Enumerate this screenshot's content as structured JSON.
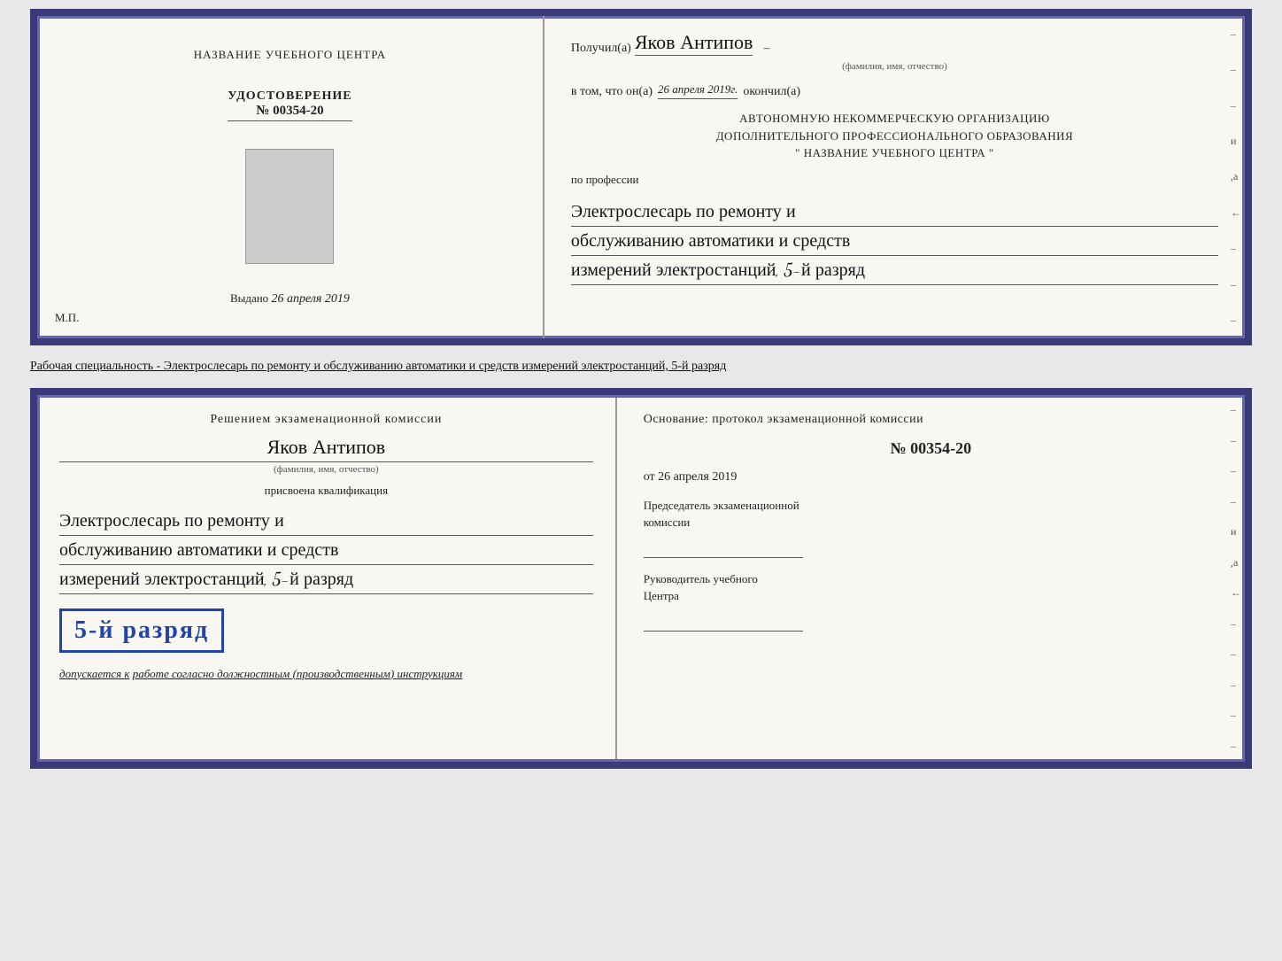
{
  "page": {
    "background": "#e8e8e8"
  },
  "top_cert": {
    "left": {
      "training_center_title": "НАЗВАНИЕ УЧЕБНОГО ЦЕНТРА",
      "udostoverenie_label": "УДОСТОВЕРЕНИЕ",
      "number": "№ 00354-20",
      "vydano_label": "Выдано",
      "vydano_date": "26 апреля 2019",
      "mp_label": "М.П."
    },
    "right": {
      "poluchil_label": "Получил(а)",
      "name": "Яков Антипов",
      "fio_label": "(фамилия, имя, отчество)",
      "vtom_label": "в том, что он(а)",
      "date": "26 апреля 2019г.",
      "okonchil_label": "окончил(а)",
      "org_line1": "АВТОНОМНУЮ НЕКОММЕРЧЕСКУЮ ОРГАНИЗАЦИЮ",
      "org_line2": "ДОПОЛНИТЕЛЬНОГО ПРОФЕССИОНАЛЬНОГО ОБРАЗОВАНИЯ",
      "org_line3": "\"  НАЗВАНИЕ УЧЕБНОГО ЦЕНТРА  \"",
      "po_professii": "по профессии",
      "profession_line1": "Электрослесарь по ремонту и",
      "profession_line2": "обслуживанию автоматики и средств",
      "profession_line3": "измерений электростанций, 5-й разряд"
    }
  },
  "specialty_divider": {
    "text": "Рабочая специальность - Электрослесарь по ремонту и обслуживанию автоматики и средств измерений электростанций, 5-й разряд"
  },
  "bottom_cert": {
    "left": {
      "resheniem_label": "Решением экзаменационной комиссии",
      "name": "Яков Антипов",
      "fio_label": "(фамилия, имя, отчество)",
      "prisvoena_label": "присвоена квалификация",
      "prof_line1": "Электрослесарь по ремонту и",
      "prof_line2": "обслуживанию автоматики и средств",
      "prof_line3": "измерений электростанций, 5-й разряд",
      "razryad_badge": "5-й разряд",
      "dopuskaetsya": "допускается к",
      "dopuskaetsya_text": "работе согласно должностным (производственным) инструкциям"
    },
    "right": {
      "osnovanie_label": "Основание: протокол экзаменационной комиссии",
      "number": "№  00354-20",
      "ot_label": "от",
      "ot_date": "26 апреля 2019",
      "predsedatel_line1": "Председатель экзаменационной",
      "predsedatel_line2": "комиссии",
      "rukovoditel_line1": "Руководитель учебного",
      "rukovoditel_line2": "Центра"
    }
  }
}
